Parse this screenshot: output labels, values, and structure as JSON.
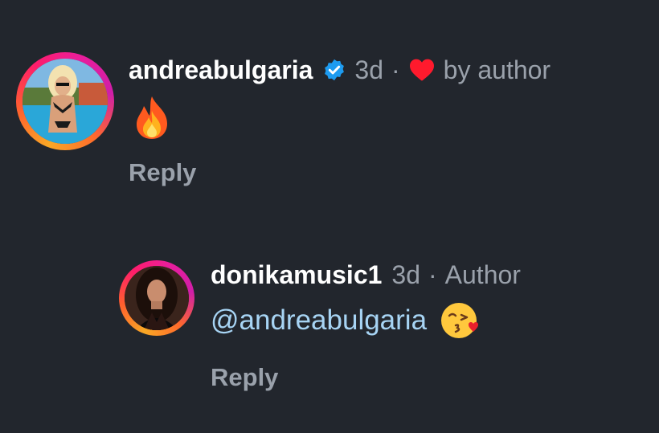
{
  "comments": [
    {
      "username": "andreabulgaria",
      "verified": true,
      "time": "3d",
      "separator": "·",
      "like_note": "by author",
      "like_color": "#ff1a2d",
      "text_icon": "fire-emoji",
      "reply_label": "Reply"
    },
    {
      "username": "donikamusic1",
      "time": "3d",
      "separator": "·",
      "role": "Author",
      "mention": "@andreabulgaria",
      "text_icon": "kissing-face-emoji",
      "reply_label": "Reply"
    }
  ],
  "colors": {
    "background": "#22262d",
    "username": "#ffffff",
    "muted": "#9aa1ab",
    "mention": "#a7d4f4",
    "verified": "#1d9bf0"
  }
}
